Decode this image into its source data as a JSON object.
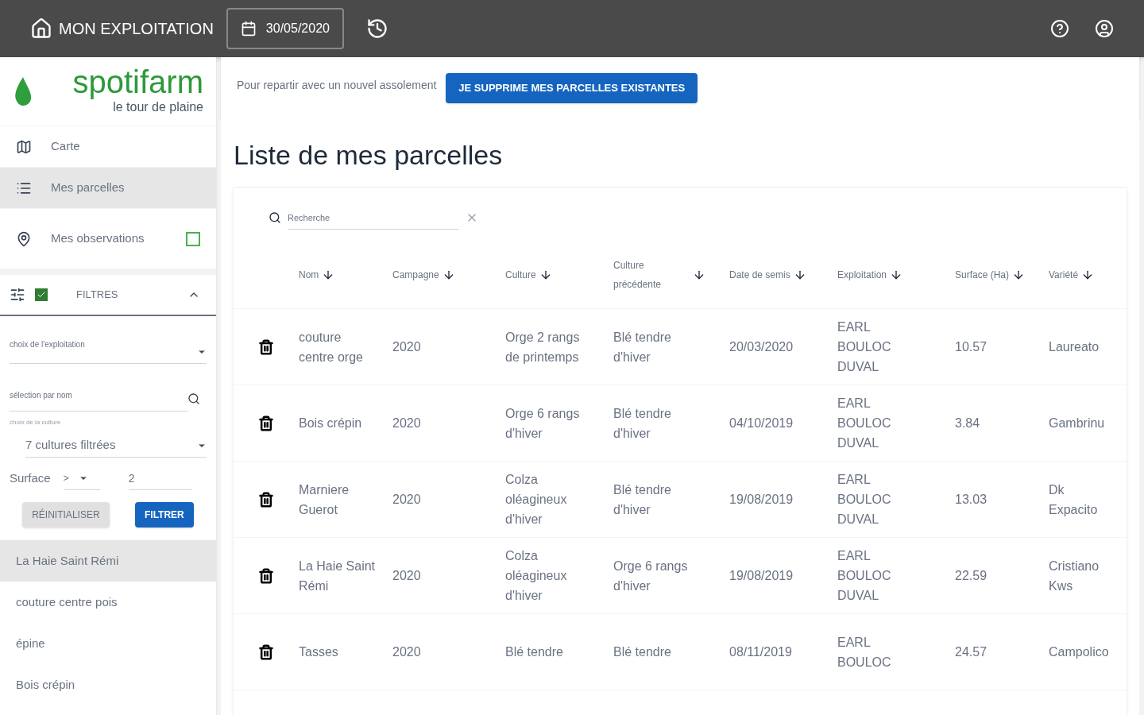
{
  "topbar": {
    "title": "MON EXPLOITATION",
    "date": "30/05/2020"
  },
  "brand": {
    "name": "spotifarm",
    "tagline": "le tour de plaine"
  },
  "nav": [
    {
      "kind": "map",
      "label": "Carte",
      "selected": false
    },
    {
      "kind": "list",
      "label": "Mes parcelles",
      "selected": true
    },
    {
      "kind": "pin",
      "label": "Mes observations",
      "selected": false,
      "checked": false
    }
  ],
  "filters": {
    "label": "FILTRES",
    "checked": true,
    "expanded": true,
    "exploitation": {
      "placeholder": "choix de l'exploitation"
    },
    "name_search": {
      "placeholder": "sélection par nom"
    },
    "culture": {
      "label": "choix de la culture",
      "value": "7 cultures filtrées"
    },
    "surface": {
      "label": "Surface",
      "operator": ">",
      "value": "2"
    },
    "buttons": [
      "RÉINITIALISER",
      "FILTRER"
    ]
  },
  "parcel_list": [
    {
      "label": "La Haie Saint Rémi",
      "selected": true
    },
    {
      "label": "couture centre pois",
      "selected": false
    },
    {
      "label": "épine",
      "selected": false
    },
    {
      "label": "Bois crépin",
      "selected": false
    }
  ],
  "banner": {
    "text": "Pour repartir avec un nouvel assolement",
    "button": "JE SUPPRIME MES PARCELLES EXISTANTES"
  },
  "page_title": "Liste de mes parcelles",
  "search": {
    "placeholder": "Recherche"
  },
  "table": {
    "columns": [
      "Nom",
      "Campagne",
      "Culture",
      "Culture précédente",
      "Date de semis",
      "Exploitation",
      "Surface (Ha)",
      "Variété"
    ],
    "rows": [
      [
        "couture centre orge",
        "2020",
        "Orge 2 rangs de printemps",
        "Blé tendre d'hiver",
        "20/03/2020",
        "EARL BOULOC DUVAL",
        "10.57",
        "Laureato"
      ],
      [
        "Bois crépin",
        "2020",
        "Orge 6 rangs d'hiver",
        "Blé tendre d'hiver",
        "04/10/2019",
        "EARL BOULOC DUVAL",
        "3.84",
        "Gambrinu"
      ],
      [
        "Marniere Guerot",
        "2020",
        "Colza oléagineux d'hiver",
        "Blé tendre d'hiver",
        "19/08/2019",
        "EARL BOULOC DUVAL",
        "13.03",
        "Dk Expacito"
      ],
      [
        "La Haie Saint Rémi",
        "2020",
        "Colza oléagineux d'hiver",
        "Orge 6 rangs d'hiver",
        "19/08/2019",
        "EARL BOULOC DUVAL",
        "22.59",
        "Cristiano Kws"
      ],
      [
        "Tasses",
        "2020",
        "Blé tendre",
        "Blé tendre",
        "08/11/2019",
        "EARL BOULOC",
        "24.57",
        "Campolico"
      ]
    ]
  }
}
